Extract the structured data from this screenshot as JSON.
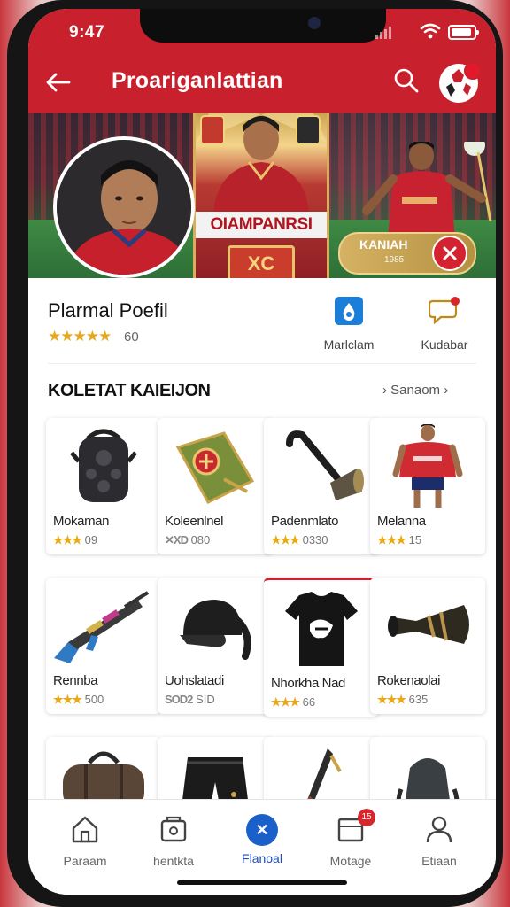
{
  "status_bar": {
    "time": "9:47"
  },
  "app_bar": {
    "title": "Proariganlattian"
  },
  "hero": {
    "card_text": "OIAMPANRSI",
    "card_badge": "XC",
    "pill_title": "KANIAH",
    "pill_sub": "1985"
  },
  "profile": {
    "name": "Plarmal Poefil",
    "stars": "★★★★★",
    "rating": "60",
    "actions": [
      {
        "label": "Marlclam",
        "icon": "water-drop-icon"
      },
      {
        "label": "Kudabar",
        "icon": "chat-bubble-icon"
      }
    ]
  },
  "section": {
    "title": "KOLETAT KAIEIJON",
    "see_all": "Sanaom"
  },
  "items": [
    {
      "name": "Mokaman",
      "stars": "★★★",
      "value": "09",
      "icon": "backpack-icon"
    },
    {
      "name": "Koleenlnel",
      "stars": "✕XD",
      "value": "080",
      "icon": "pennant-icon"
    },
    {
      "name": "Padenmlato",
      "stars": "★★★",
      "value": "0330",
      "icon": "vuvuzela-icon"
    },
    {
      "name": "Melanna",
      "stars": "★★★",
      "value": "15",
      "icon": "jersey-player-icon"
    },
    {
      "name": "Rennba",
      "stars": "★★★",
      "value": "500",
      "icon": "rifle-icon"
    },
    {
      "name": "Uohslatadi",
      "stars": "SOD2",
      "value": "SID",
      "icon": "cap-icon"
    },
    {
      "name": "Nhorkha Nad",
      "stars": "★★★",
      "value": "66",
      "icon": "tshirt-icon"
    },
    {
      "name": "Rokenaolai",
      "stars": "★★★",
      "value": "635",
      "icon": "horn-icon"
    },
    {
      "name": "",
      "stars": "",
      "value": "",
      "icon": "duffel-bag-icon"
    },
    {
      "name": "",
      "stars": "",
      "value": "",
      "icon": "shorts-icon"
    },
    {
      "name": "",
      "stars": "",
      "value": "",
      "icon": "scarf-icon"
    },
    {
      "name": "",
      "stars": "",
      "value": "",
      "icon": "bag-icon"
    }
  ],
  "bottom_nav": [
    {
      "label": "Paraam",
      "icon": "home-icon"
    },
    {
      "label": "hentkta",
      "icon": "wallet-icon"
    },
    {
      "label": "Flanoal",
      "icon": "center-x-icon",
      "active": true
    },
    {
      "label": "Motage",
      "icon": "inbox-icon",
      "badge": "15"
    },
    {
      "label": "Etiaan",
      "icon": "person-icon"
    }
  ],
  "colors": {
    "brand_red": "#c8202c",
    "star_gold": "#e8a817",
    "active_blue": "#1b5fc8"
  }
}
